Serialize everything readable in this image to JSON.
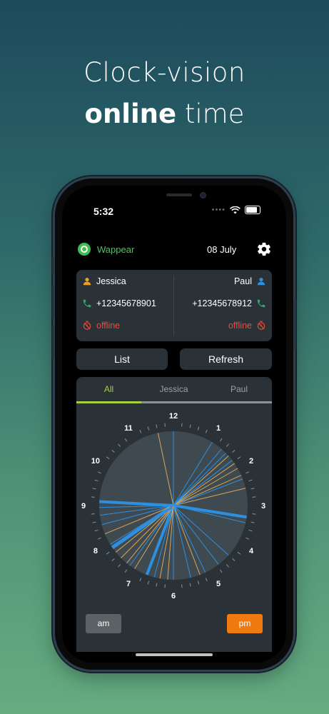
{
  "headline": {
    "line1": "Clock-vision",
    "line2_bold": "online",
    "line2_rest": " time"
  },
  "status_bar": {
    "time": "5:32",
    "dots": "••••"
  },
  "app": {
    "name": "Wappear",
    "date": "08 July"
  },
  "contacts": [
    {
      "name": "Jessica",
      "phone": "+12345678901",
      "status": "offline",
      "color": "#f0a020"
    },
    {
      "name": "Paul",
      "phone": "+12345678912",
      "status": "offline",
      "color": "#2d8fe0"
    }
  ],
  "buttons": {
    "list": "List",
    "refresh": "Refresh"
  },
  "tabs": [
    "All",
    "Jessica",
    "Paul"
  ],
  "active_tab": "All",
  "clock": {
    "numbers": [
      "12",
      "1",
      "2",
      "3",
      "4",
      "5",
      "6",
      "7",
      "8",
      "9",
      "10",
      "11"
    ],
    "colors": {
      "jessica": "#d9a45a",
      "paul": "#2d8fe0",
      "face": "#3f4a50"
    },
    "sessions": [
      {
        "who": "paul",
        "hour": 0.0,
        "w": 1
      },
      {
        "who": "jessica",
        "hour": 11.6,
        "w": 1
      },
      {
        "who": "paul",
        "hour": 1.35,
        "w": 1
      },
      {
        "who": "paul",
        "hour": 1.05,
        "w": 1
      },
      {
        "who": "jessica",
        "hour": 1.6,
        "w": 1
      },
      {
        "who": "paul",
        "hour": 1.75,
        "w": 1
      },
      {
        "who": "jessica",
        "hour": 1.85,
        "w": 1
      },
      {
        "who": "jessica",
        "hour": 2.0,
        "w": 1
      },
      {
        "who": "jessica",
        "hour": 2.2,
        "w": 1
      },
      {
        "who": "paul",
        "hour": 2.3,
        "w": 1
      },
      {
        "who": "jessica",
        "hour": 2.55,
        "w": 1
      },
      {
        "who": "paul",
        "hour": 3.3,
        "w": 4
      },
      {
        "who": "paul",
        "hour": 3.45,
        "w": 1
      },
      {
        "who": "paul",
        "hour": 4.4,
        "w": 1
      },
      {
        "who": "paul",
        "hour": 4.75,
        "w": 1
      },
      {
        "who": "paul",
        "hour": 5.15,
        "w": 1
      },
      {
        "who": "jessica",
        "hour": 5.3,
        "w": 1
      },
      {
        "who": "paul",
        "hour": 5.55,
        "w": 1
      },
      {
        "who": "paul",
        "hour": 6.0,
        "w": 1
      },
      {
        "who": "jessica",
        "hour": 6.15,
        "w": 1
      },
      {
        "who": "paul",
        "hour": 6.5,
        "w": 1
      },
      {
        "who": "paul",
        "hour": 6.7,
        "w": 4
      },
      {
        "who": "jessica",
        "hour": 7.05,
        "w": 1
      },
      {
        "who": "paul",
        "hour": 7.2,
        "w": 1
      },
      {
        "who": "jessica",
        "hour": 7.3,
        "w": 1
      },
      {
        "who": "jessica",
        "hour": 7.5,
        "w": 1
      },
      {
        "who": "jessica",
        "hour": 7.7,
        "w": 1
      },
      {
        "who": "paul",
        "hour": 7.85,
        "w": 5
      },
      {
        "who": "jessica",
        "hour": 8.25,
        "w": 1
      },
      {
        "who": "paul",
        "hour": 8.5,
        "w": 1
      },
      {
        "who": "paul",
        "hour": 8.75,
        "w": 1
      },
      {
        "who": "paul",
        "hour": 8.95,
        "w": 1
      },
      {
        "who": "paul",
        "hour": 9.1,
        "w": 4
      },
      {
        "who": "jessica",
        "hour": 6.35,
        "w": 1
      },
      {
        "who": "paul",
        "hour": 7.95,
        "w": 1
      },
      {
        "who": "paul",
        "hour": 1.5,
        "w": 1
      }
    ]
  },
  "ampm": {
    "am": "am",
    "pm": "pm",
    "active": "pm"
  }
}
